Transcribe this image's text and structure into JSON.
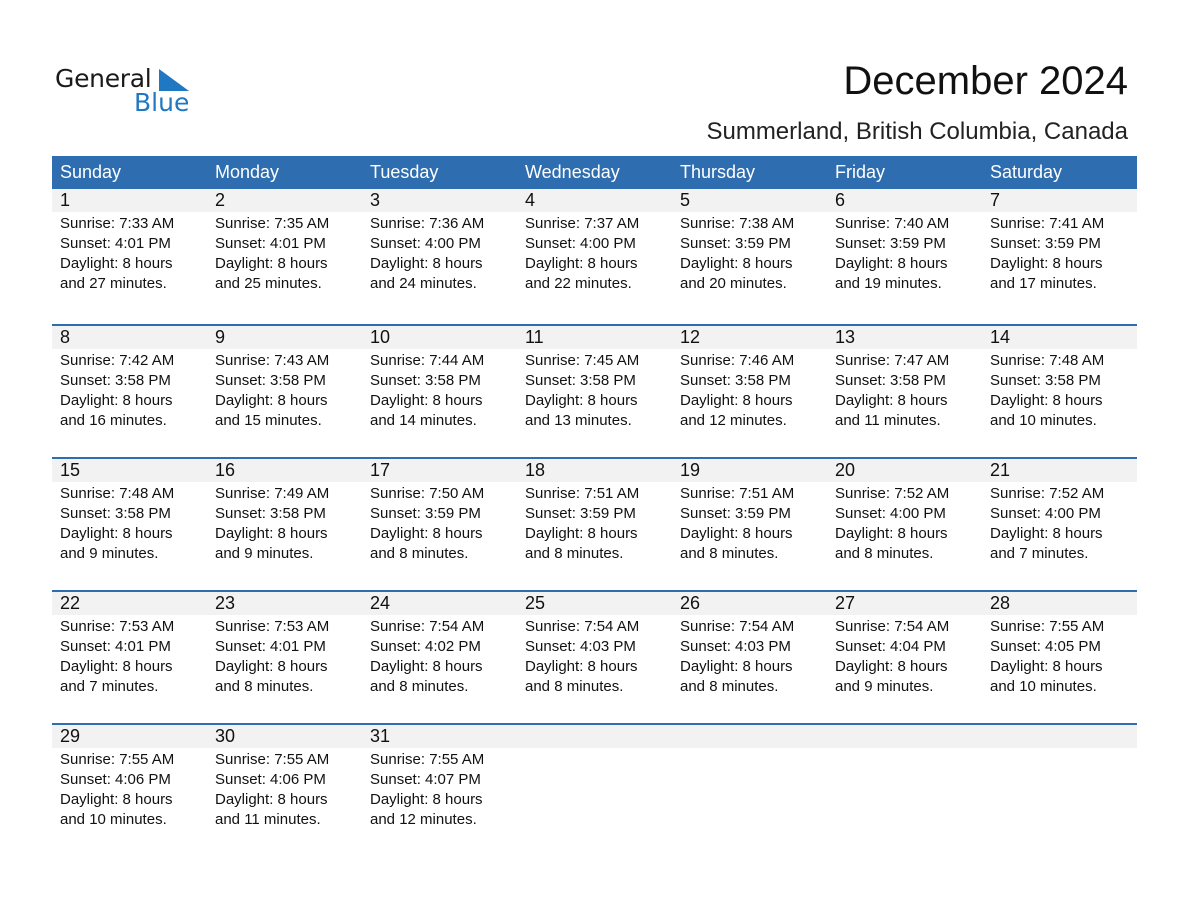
{
  "logo": {
    "line1": "General",
    "line2": "Blue",
    "icon": "triangle-icon",
    "accent": "#1f78c1"
  },
  "header": {
    "title": "December 2024",
    "location": "Summerland, British Columbia, Canada"
  },
  "colors": {
    "header_bg": "#2e6db0",
    "day_band": "#f2f2f2"
  },
  "weekdays": [
    "Sunday",
    "Monday",
    "Tuesday",
    "Wednesday",
    "Thursday",
    "Friday",
    "Saturday"
  ],
  "weeks": [
    [
      {
        "day": "1",
        "sunrise": "Sunrise: 7:33 AM",
        "sunset": "Sunset: 4:01 PM",
        "daylight1": "Daylight: 8 hours",
        "daylight2": "and 27 minutes."
      },
      {
        "day": "2",
        "sunrise": "Sunrise: 7:35 AM",
        "sunset": "Sunset: 4:01 PM",
        "daylight1": "Daylight: 8 hours",
        "daylight2": "and 25 minutes."
      },
      {
        "day": "3",
        "sunrise": "Sunrise: 7:36 AM",
        "sunset": "Sunset: 4:00 PM",
        "daylight1": "Daylight: 8 hours",
        "daylight2": "and 24 minutes."
      },
      {
        "day": "4",
        "sunrise": "Sunrise: 7:37 AM",
        "sunset": "Sunset: 4:00 PM",
        "daylight1": "Daylight: 8 hours",
        "daylight2": "and 22 minutes."
      },
      {
        "day": "5",
        "sunrise": "Sunrise: 7:38 AM",
        "sunset": "Sunset: 3:59 PM",
        "daylight1": "Daylight: 8 hours",
        "daylight2": "and 20 minutes."
      },
      {
        "day": "6",
        "sunrise": "Sunrise: 7:40 AM",
        "sunset": "Sunset: 3:59 PM",
        "daylight1": "Daylight: 8 hours",
        "daylight2": "and 19 minutes."
      },
      {
        "day": "7",
        "sunrise": "Sunrise: 7:41 AM",
        "sunset": "Sunset: 3:59 PM",
        "daylight1": "Daylight: 8 hours",
        "daylight2": "and 17 minutes."
      }
    ],
    [
      {
        "day": "8",
        "sunrise": "Sunrise: 7:42 AM",
        "sunset": "Sunset: 3:58 PM",
        "daylight1": "Daylight: 8 hours",
        "daylight2": "and 16 minutes."
      },
      {
        "day": "9",
        "sunrise": "Sunrise: 7:43 AM",
        "sunset": "Sunset: 3:58 PM",
        "daylight1": "Daylight: 8 hours",
        "daylight2": "and 15 minutes."
      },
      {
        "day": "10",
        "sunrise": "Sunrise: 7:44 AM",
        "sunset": "Sunset: 3:58 PM",
        "daylight1": "Daylight: 8 hours",
        "daylight2": "and 14 minutes."
      },
      {
        "day": "11",
        "sunrise": "Sunrise: 7:45 AM",
        "sunset": "Sunset: 3:58 PM",
        "daylight1": "Daylight: 8 hours",
        "daylight2": "and 13 minutes."
      },
      {
        "day": "12",
        "sunrise": "Sunrise: 7:46 AM",
        "sunset": "Sunset: 3:58 PM",
        "daylight1": "Daylight: 8 hours",
        "daylight2": "and 12 minutes."
      },
      {
        "day": "13",
        "sunrise": "Sunrise: 7:47 AM",
        "sunset": "Sunset: 3:58 PM",
        "daylight1": "Daylight: 8 hours",
        "daylight2": "and 11 minutes."
      },
      {
        "day": "14",
        "sunrise": "Sunrise: 7:48 AM",
        "sunset": "Sunset: 3:58 PM",
        "daylight1": "Daylight: 8 hours",
        "daylight2": "and 10 minutes."
      }
    ],
    [
      {
        "day": "15",
        "sunrise": "Sunrise: 7:48 AM",
        "sunset": "Sunset: 3:58 PM",
        "daylight1": "Daylight: 8 hours",
        "daylight2": "and 9 minutes."
      },
      {
        "day": "16",
        "sunrise": "Sunrise: 7:49 AM",
        "sunset": "Sunset: 3:58 PM",
        "daylight1": "Daylight: 8 hours",
        "daylight2": "and 9 minutes."
      },
      {
        "day": "17",
        "sunrise": "Sunrise: 7:50 AM",
        "sunset": "Sunset: 3:59 PM",
        "daylight1": "Daylight: 8 hours",
        "daylight2": "and 8 minutes."
      },
      {
        "day": "18",
        "sunrise": "Sunrise: 7:51 AM",
        "sunset": "Sunset: 3:59 PM",
        "daylight1": "Daylight: 8 hours",
        "daylight2": "and 8 minutes."
      },
      {
        "day": "19",
        "sunrise": "Sunrise: 7:51 AM",
        "sunset": "Sunset: 3:59 PM",
        "daylight1": "Daylight: 8 hours",
        "daylight2": "and 8 minutes."
      },
      {
        "day": "20",
        "sunrise": "Sunrise: 7:52 AM",
        "sunset": "Sunset: 4:00 PM",
        "daylight1": "Daylight: 8 hours",
        "daylight2": "and 8 minutes."
      },
      {
        "day": "21",
        "sunrise": "Sunrise: 7:52 AM",
        "sunset": "Sunset: 4:00 PM",
        "daylight1": "Daylight: 8 hours",
        "daylight2": "and 7 minutes."
      }
    ],
    [
      {
        "day": "22",
        "sunrise": "Sunrise: 7:53 AM",
        "sunset": "Sunset: 4:01 PM",
        "daylight1": "Daylight: 8 hours",
        "daylight2": "and 7 minutes."
      },
      {
        "day": "23",
        "sunrise": "Sunrise: 7:53 AM",
        "sunset": "Sunset: 4:01 PM",
        "daylight1": "Daylight: 8 hours",
        "daylight2": "and 8 minutes."
      },
      {
        "day": "24",
        "sunrise": "Sunrise: 7:54 AM",
        "sunset": "Sunset: 4:02 PM",
        "daylight1": "Daylight: 8 hours",
        "daylight2": "and 8 minutes."
      },
      {
        "day": "25",
        "sunrise": "Sunrise: 7:54 AM",
        "sunset": "Sunset: 4:03 PM",
        "daylight1": "Daylight: 8 hours",
        "daylight2": "and 8 minutes."
      },
      {
        "day": "26",
        "sunrise": "Sunrise: 7:54 AM",
        "sunset": "Sunset: 4:03 PM",
        "daylight1": "Daylight: 8 hours",
        "daylight2": "and 8 minutes."
      },
      {
        "day": "27",
        "sunrise": "Sunrise: 7:54 AM",
        "sunset": "Sunset: 4:04 PM",
        "daylight1": "Daylight: 8 hours",
        "daylight2": "and 9 minutes."
      },
      {
        "day": "28",
        "sunrise": "Sunrise: 7:55 AM",
        "sunset": "Sunset: 4:05 PM",
        "daylight1": "Daylight: 8 hours",
        "daylight2": "and 10 minutes."
      }
    ],
    [
      {
        "day": "29",
        "sunrise": "Sunrise: 7:55 AM",
        "sunset": "Sunset: 4:06 PM",
        "daylight1": "Daylight: 8 hours",
        "daylight2": "and 10 minutes."
      },
      {
        "day": "30",
        "sunrise": "Sunrise: 7:55 AM",
        "sunset": "Sunset: 4:06 PM",
        "daylight1": "Daylight: 8 hours",
        "daylight2": "and 11 minutes."
      },
      {
        "day": "31",
        "sunrise": "Sunrise: 7:55 AM",
        "sunset": "Sunset: 4:07 PM",
        "daylight1": "Daylight: 8 hours",
        "daylight2": "and 12 minutes."
      },
      null,
      null,
      null,
      null
    ]
  ]
}
